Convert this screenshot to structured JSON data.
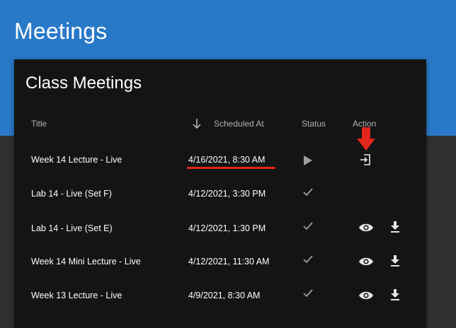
{
  "page": {
    "title": "Meetings"
  },
  "card": {
    "title": "Class Meetings",
    "columns": {
      "title": "Title",
      "scheduled_at": "Scheduled At",
      "status": "Status",
      "action": "Action"
    },
    "rows": [
      {
        "title": "Week 14 Lecture - Live",
        "scheduled_at": "4/16/2021, 8:30 AM",
        "status": "play-icon",
        "actions": [
          "enter-icon"
        ]
      },
      {
        "title": "Lab 14 - Live (Set F)",
        "scheduled_at": "4/12/2021, 3:30 PM",
        "status": "check-icon",
        "actions": []
      },
      {
        "title": "Lab 14 - Live (Set E)",
        "scheduled_at": "4/12/2021, 1:30 PM",
        "status": "check-icon",
        "actions": [
          "eye-icon",
          "download-icon"
        ]
      },
      {
        "title": "Week 14 Mini Lecture - Live",
        "scheduled_at": "4/12/2021, 11:30 AM",
        "status": "check-icon",
        "actions": [
          "eye-icon",
          "download-icon"
        ]
      },
      {
        "title": "Week 13 Lecture - Live",
        "scheduled_at": "4/9/2021, 8:30 AM",
        "status": "check-icon",
        "actions": [
          "eye-icon",
          "download-icon"
        ]
      }
    ]
  },
  "colors": {
    "app_bar": "#2979c8",
    "background": "#303030",
    "card": "#141414",
    "annotation": "#e0261d"
  }
}
